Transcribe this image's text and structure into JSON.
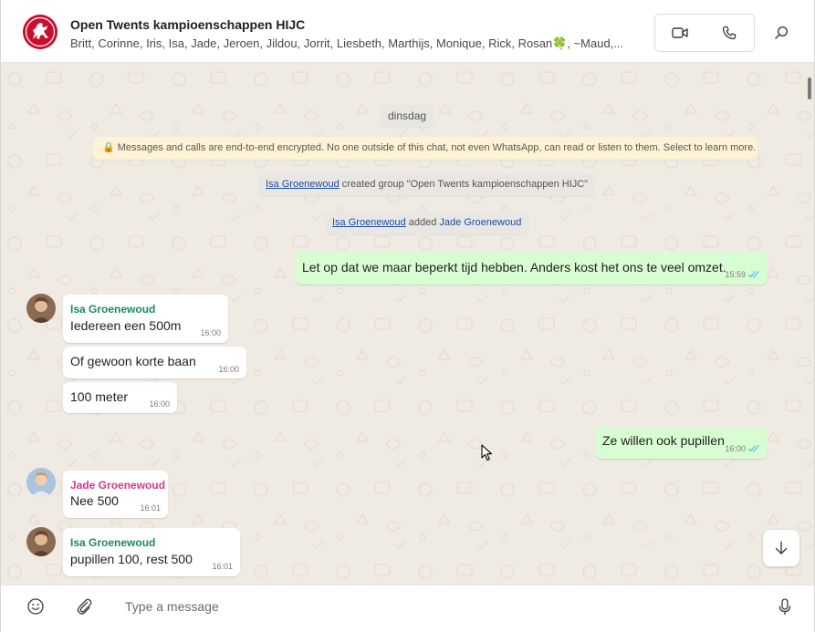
{
  "header": {
    "title": "Open Twents kampioenschappen HIJC",
    "members": "Britt, Corinne, Iris, Isa, Jade, Jeroen, Jildou, Jorrit, Liesbeth, Marthijs, Monique, Rick, Rosan🍀, ~Maud,...",
    "icons": [
      "video-call-icon",
      "voice-call-icon",
      "search-icon"
    ]
  },
  "chat": {
    "date_label": "dinsdag",
    "encryption_notice": "🔒 Messages and calls are end-to-end encrypted. No one outside of this chat, not even WhatsApp, can read or listen to them. Select to learn more.",
    "system_messages": [
      {
        "actor": "Isa Groenewoud",
        "text": " created group \"Open Twents kampioenschappen HIJC\""
      },
      {
        "actor": "Isa Groenewoud",
        "text": " added ",
        "target": "Jade Groenewoud"
      }
    ],
    "messages": [
      {
        "direction": "out",
        "text": "Let op dat we maar beperkt tijd hebben. Anders kost het ons te veel omzet.",
        "time": "15:59",
        "read": true
      },
      {
        "direction": "in",
        "sender": "Isa Groenewoud",
        "sender_color": "#1c8a5a",
        "text": "Iedereen een 500m",
        "time": "16:00"
      },
      {
        "direction": "in",
        "text": "Of gewoon korte baan",
        "time": "16:00"
      },
      {
        "direction": "in",
        "text": "100 meter",
        "time": "16:00"
      },
      {
        "direction": "out",
        "text": "Ze willen ook pupillen",
        "time": "16:00",
        "read": true
      },
      {
        "direction": "in",
        "sender": "Jade Groenewoud",
        "sender_color": "#d13b8f",
        "text": "Nee 500",
        "time": "16:01"
      },
      {
        "direction": "in",
        "sender": "Isa Groenewoud",
        "sender_color": "#1c8a5a",
        "text": "pupillen 100, rest 500",
        "time": "16:01"
      }
    ]
  },
  "composer": {
    "placeholder": "Type a message",
    "icons": [
      "emoji-icon",
      "attach-icon",
      "microphone-icon"
    ]
  },
  "colors": {
    "outgoing_bubble": "#d9fdd3",
    "incoming_bubble": "#ffffff",
    "chat_background": "#efeae2",
    "read_ticks": "#53bdeb",
    "group_avatar": "#c8102e"
  }
}
